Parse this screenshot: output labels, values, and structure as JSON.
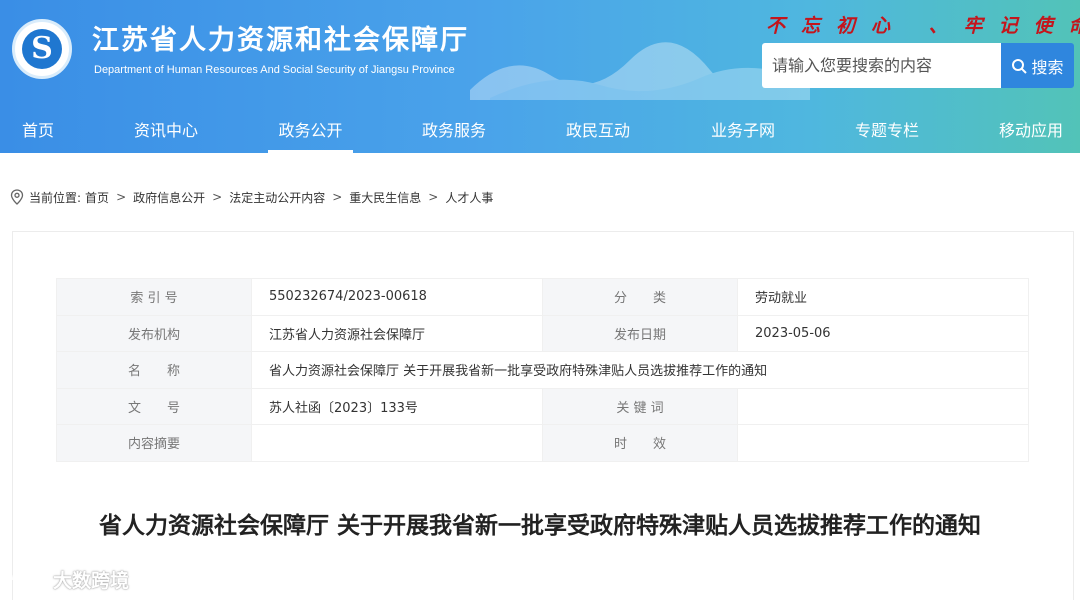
{
  "header": {
    "title": "江苏省人力资源和社会保障厅",
    "subtitle": "Department of Human Resources And Social Security of Jiangsu Province",
    "slogan": "不忘初心 、牢记使命",
    "search": {
      "placeholder": "请输入您要搜索的内容",
      "button_label": "搜索"
    }
  },
  "nav": {
    "items": [
      {
        "label": "首页"
      },
      {
        "label": "资讯中心"
      },
      {
        "label": "政务公开"
      },
      {
        "label": "政务服务"
      },
      {
        "label": "政民互动"
      },
      {
        "label": "业务子网"
      },
      {
        "label": "专题专栏"
      },
      {
        "label": "移动应用"
      }
    ],
    "active": "政务公开"
  },
  "breadcrumb": {
    "prefix": "当前位置:",
    "items": [
      "首页",
      "政府信息公开",
      "法定主动公开内容",
      "重大民生信息",
      "人才人事"
    ],
    "separator": ">"
  },
  "meta": {
    "index_label": "索 引 号",
    "index_value": "550232674/2023-00618",
    "category_label": "分　　类",
    "category_value": "劳动就业",
    "publisher_label": "发布机构",
    "publisher_value": "江苏省人力资源社会保障厅",
    "date_label": "发布日期",
    "date_value": "2023-05-06",
    "name_label": "名　　称",
    "name_value": "省人力资源社会保障厅 关于开展我省新一批享受政府特殊津贴人员选拔推荐工作的通知",
    "doc_no_label": "文　　号",
    "doc_no_value": "苏人社函〔2023〕133号",
    "keywords_label": "关 键 词",
    "keywords_value": "",
    "summary_label": "内容摘要",
    "summary_value": "",
    "validity_label": "时　　效",
    "validity_value": ""
  },
  "article": {
    "title": "省人力资源社会保障厅 关于开展我省新一批享受政府特殊津贴人员选拔推荐工作的通知"
  },
  "watermark": {
    "text": "大数跨境"
  },
  "colors": {
    "header_start": "#3a8ee6",
    "header_end": "#52c3b8",
    "slogan": "#c4151c",
    "search_button": "#2f86de"
  }
}
